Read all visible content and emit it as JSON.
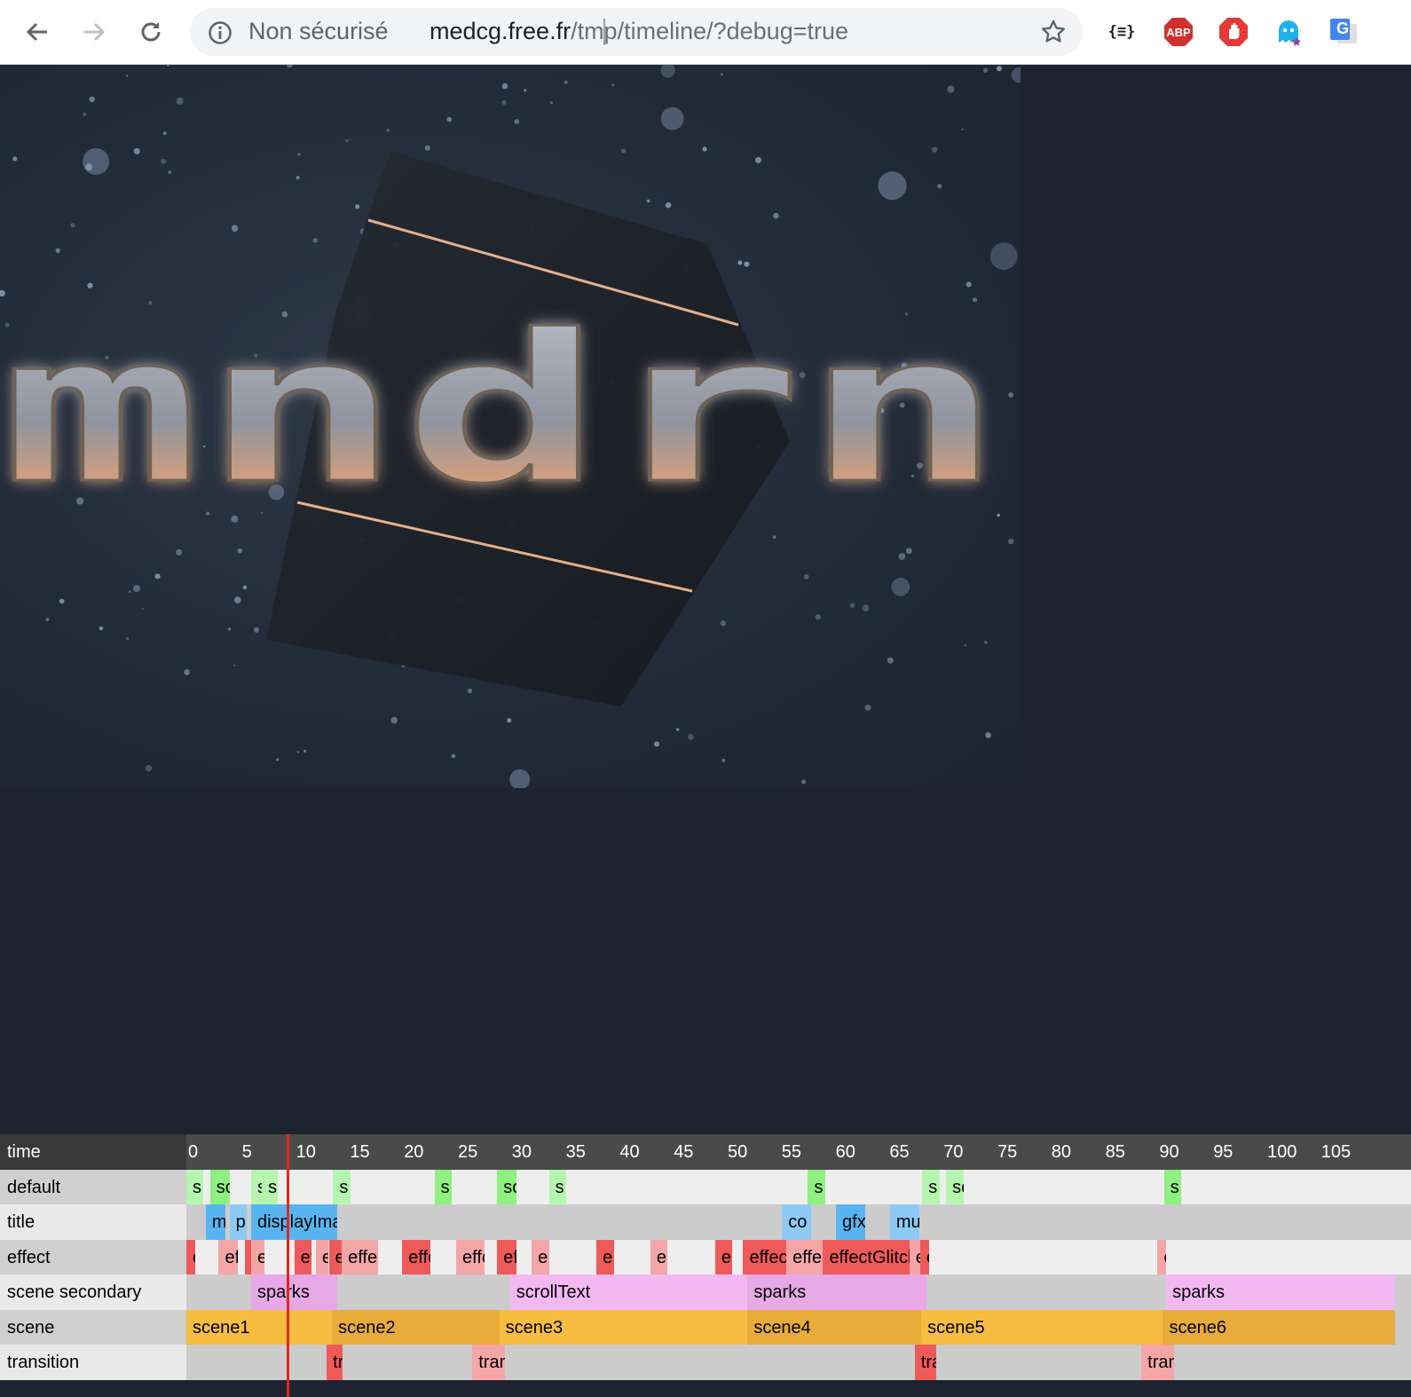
{
  "browser": {
    "security_label": "Non sécurisé",
    "url_host": "medcg.free.fr",
    "url_path": "/tmp/timeline/?debug=true",
    "extensions": [
      {
        "name": "json-formatter-extension-icon",
        "text": "{≡}"
      },
      {
        "name": "adblock-plus-extension-icon",
        "text": "ABP"
      },
      {
        "name": "stop-hand-extension-icon",
        "text": ""
      },
      {
        "name": "ghostery-extension-icon",
        "text": ""
      },
      {
        "name": "google-translate-extension-icon",
        "text": "G"
      }
    ]
  },
  "demo": {
    "logo_text": "mndrn"
  },
  "timeline": {
    "header_label": "time",
    "ticks": [
      "0",
      "5",
      "10",
      "15",
      "20",
      "25",
      "30",
      "35",
      "40",
      "45",
      "50",
      "55",
      "60",
      "65",
      "70",
      "75",
      "80",
      "85",
      "90",
      "95",
      "100",
      "105"
    ],
    "playhead_time": 8.8,
    "rows": [
      {
        "label": "default",
        "bg": "#eeeeee",
        "blocks": [
          {
            "start": 0.0,
            "end": 1.6,
            "text": "s",
            "color": "#b6f5b0"
          },
          {
            "start": 2.2,
            "end": 4.0,
            "text": "sc",
            "color": "#8ef07e"
          },
          {
            "start": 6.0,
            "end": 7.0,
            "text": "s",
            "color": "#b6f5b0"
          },
          {
            "start": 7.0,
            "end": 8.5,
            "text": "sc",
            "color": "#b6f5b0"
          },
          {
            "start": 13.6,
            "end": 15.2,
            "text": "s",
            "color": "#b6f5b0"
          },
          {
            "start": 23.0,
            "end": 24.6,
            "text": "s",
            "color": "#8ef07e"
          },
          {
            "start": 28.8,
            "end": 30.6,
            "text": "sc",
            "color": "#8ef07e"
          },
          {
            "start": 33.6,
            "end": 35.2,
            "text": "s",
            "color": "#b6f5b0"
          },
          {
            "start": 57.6,
            "end": 59.2,
            "text": "s",
            "color": "#8ef07e"
          },
          {
            "start": 68.2,
            "end": 69.8,
            "text": "s",
            "color": "#b6f5b0"
          },
          {
            "start": 70.4,
            "end": 72.0,
            "text": "sc",
            "color": "#b6f5b0"
          },
          {
            "start": 90.6,
            "end": 92.2,
            "text": "s",
            "color": "#8ef07e"
          }
        ]
      },
      {
        "label": "title",
        "bg": "#cccccc",
        "blocks": [
          {
            "start": 1.8,
            "end": 3.6,
            "text": "m",
            "color": "#58b4f0"
          },
          {
            "start": 4.0,
            "end": 5.6,
            "text": "p",
            "color": "#8ccaf4"
          },
          {
            "start": 6.0,
            "end": 14.0,
            "text": "displayIma",
            "color": "#58b4f0"
          },
          {
            "start": 55.2,
            "end": 57.9,
            "text": "co",
            "color": "#8ccaf4"
          },
          {
            "start": 60.2,
            "end": 62.9,
            "text": "gfx",
            "color": "#58b4f0"
          },
          {
            "start": 65.2,
            "end": 67.9,
            "text": "mu",
            "color": "#8ccaf4"
          }
        ]
      },
      {
        "label": "effect",
        "bg": "#eeeeee",
        "blocks": [
          {
            "start": 0.0,
            "end": 0.8,
            "text": "e",
            "color": "#ee5a5a"
          },
          {
            "start": 3.0,
            "end": 4.8,
            "text": "ef",
            "color": "#f4a6a6"
          },
          {
            "start": 5.4,
            "end": 6.0,
            "text": "e",
            "color": "#ee5a5a"
          },
          {
            "start": 6.0,
            "end": 7.2,
            "text": "e",
            "color": "#f4a6a6"
          },
          {
            "start": 10.0,
            "end": 11.6,
            "text": "ef",
            "color": "#ee5a5a"
          },
          {
            "start": 12.0,
            "end": 13.2,
            "text": "e",
            "color": "#f4a6a6"
          },
          {
            "start": 13.2,
            "end": 14.4,
            "text": "e",
            "color": "#ee5a5a"
          },
          {
            "start": 14.4,
            "end": 17.8,
            "text": "effect",
            "color": "#f4a6a6"
          },
          {
            "start": 20.0,
            "end": 22.6,
            "text": "effect",
            "color": "#ee5a5a"
          },
          {
            "start": 25.0,
            "end": 27.6,
            "text": "effect",
            "color": "#f4a6a6"
          },
          {
            "start": 28.8,
            "end": 30.6,
            "text": "ef",
            "color": "#ee5a5a"
          },
          {
            "start": 32.0,
            "end": 33.6,
            "text": "e",
            "color": "#f4a6a6"
          },
          {
            "start": 38.0,
            "end": 39.6,
            "text": "e",
            "color": "#ee5a5a"
          },
          {
            "start": 43.0,
            "end": 44.6,
            "text": "e",
            "color": "#f4a6a6"
          },
          {
            "start": 49.0,
            "end": 50.6,
            "text": "e",
            "color": "#ee5a5a"
          },
          {
            "start": 51.6,
            "end": 55.6,
            "text": "effect",
            "color": "#ee5a5a"
          },
          {
            "start": 55.6,
            "end": 59.0,
            "text": "effect",
            "color": "#f4a6a6"
          },
          {
            "start": 59.0,
            "end": 67.0,
            "text": "effectGlitch",
            "color": "#ee5a5a"
          },
          {
            "start": 67.0,
            "end": 68.0,
            "text": "e",
            "color": "#f4a6a6"
          },
          {
            "start": 68.0,
            "end": 68.8,
            "text": "e",
            "color": "#ee5a5a"
          },
          {
            "start": 90.0,
            "end": 90.8,
            "text": "e",
            "color": "#f4a6a6"
          }
        ]
      },
      {
        "label": "scene secondary",
        "bg": "#cccccc",
        "blocks": [
          {
            "start": 6.0,
            "end": 14.0,
            "text": "sparks",
            "color": "#e6a8e6"
          },
          {
            "start": 30.0,
            "end": 52.0,
            "text": "scrollText",
            "color": "#f2b8f2"
          },
          {
            "start": 52.0,
            "end": 68.6,
            "text": "sparks",
            "color": "#e6a8e6"
          },
          {
            "start": 90.8,
            "end": 112.0,
            "text": "sparks",
            "color": "#f2b8f2"
          }
        ]
      },
      {
        "label": "scene",
        "bg": "#cccccc",
        "blocks": [
          {
            "start": 0.0,
            "end": 13.5,
            "text": "scene1",
            "color": "#f7bd40"
          },
          {
            "start": 13.5,
            "end": 29.0,
            "text": "scene2",
            "color": "#e9ac3a"
          },
          {
            "start": 29.0,
            "end": 52.0,
            "text": "scene3",
            "color": "#f7bd40"
          },
          {
            "start": 52.0,
            "end": 68.1,
            "text": "scene4",
            "color": "#e9ac3a"
          },
          {
            "start": 68.1,
            "end": 90.5,
            "text": "scene5",
            "color": "#f7bd40"
          },
          {
            "start": 90.5,
            "end": 112.0,
            "text": "scene6",
            "color": "#e9ac3a"
          }
        ]
      },
      {
        "label": "transition",
        "bg": "#cccccc",
        "blocks": [
          {
            "start": 13.0,
            "end": 14.5,
            "text": "tr",
            "color": "#ee5a5a"
          },
          {
            "start": 26.5,
            "end": 29.5,
            "text": "tran",
            "color": "#f4a6a6"
          },
          {
            "start": 67.5,
            "end": 69.5,
            "text": "tra",
            "color": "#ee5a5a"
          },
          {
            "start": 88.5,
            "end": 91.5,
            "text": "tran",
            "color": "#f4a6a6"
          }
        ]
      }
    ]
  }
}
